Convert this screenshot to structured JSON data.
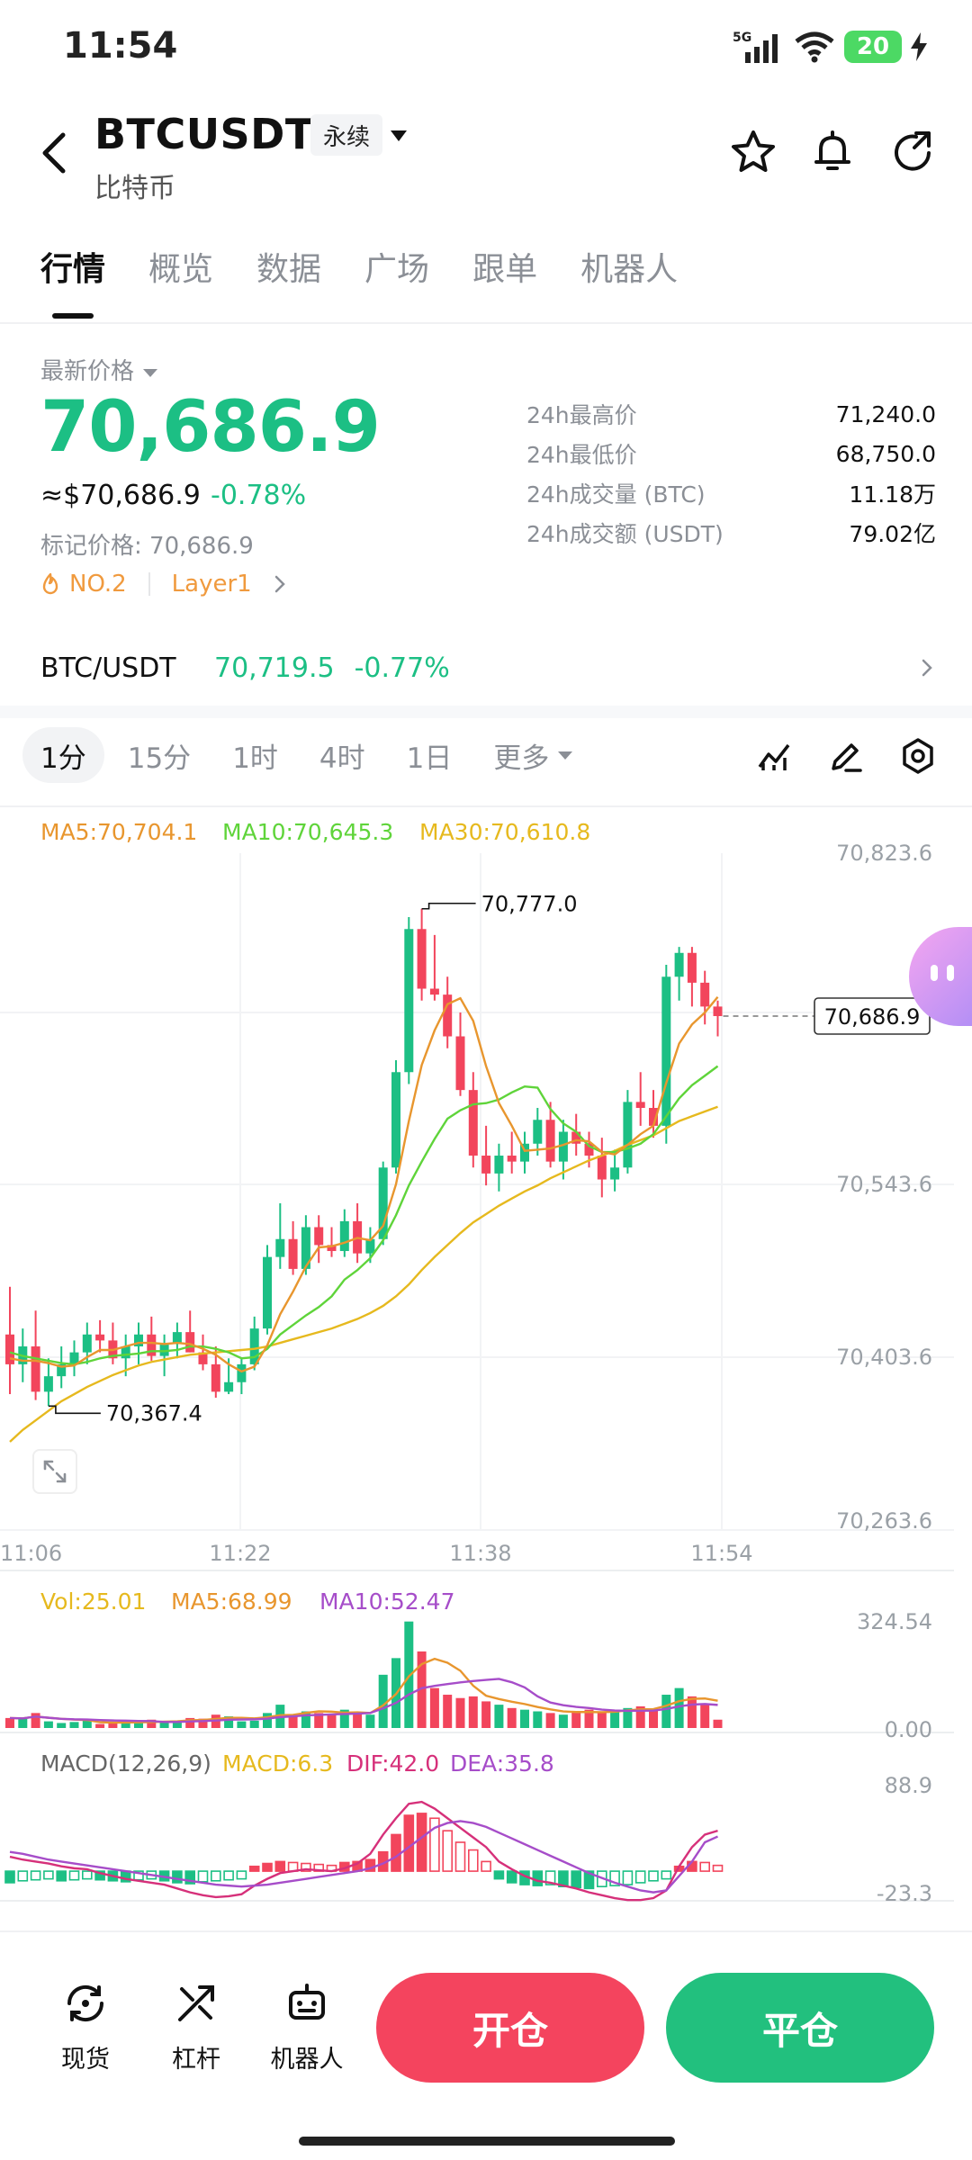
{
  "status_bar": {
    "time": "11:54",
    "network": "5G",
    "battery": "20"
  },
  "header": {
    "symbol": "BTCUSDT",
    "contract_type": "永续",
    "name": "比特币"
  },
  "tabs": [
    {
      "label": "行情"
    },
    {
      "label": "概览"
    },
    {
      "label": "数据"
    },
    {
      "label": "广场"
    },
    {
      "label": "跟单"
    },
    {
      "label": "机器人"
    }
  ],
  "price": {
    "label": "最新价格",
    "last": "70,686.9",
    "usd": "≈$70,686.9",
    "change": "-0.78%",
    "mark_label": "标记价格: 70,686.9",
    "rank": "NO.2",
    "category": "Layer1"
  },
  "stats": [
    {
      "label": "24h最高价",
      "value": "71,240.0"
    },
    {
      "label": "24h最低价",
      "value": "68,750.0"
    },
    {
      "label": "24h成交量 (BTC)",
      "value": "11.18万"
    },
    {
      "label": "24h成交额 (USDT)",
      "value": "79.02亿"
    }
  ],
  "spot": {
    "pair": "BTC/USDT",
    "price": "70,719.5",
    "change": "-0.77%"
  },
  "timeframes": [
    {
      "label": "1分"
    },
    {
      "label": "15分"
    },
    {
      "label": "1时"
    },
    {
      "label": "4时"
    },
    {
      "label": "1日"
    },
    {
      "label": "更多"
    }
  ],
  "ma_legend": {
    "ma5": "MA5:70,704.1",
    "ma10": "MA10:70,645.3",
    "ma30": "MA30:70,610.8"
  },
  "price_axis": [
    "70,823.6",
    "70,543.6",
    "70,403.6",
    "70,263.6"
  ],
  "time_axis": [
    "11:06",
    "11:22",
    "11:38",
    "11:54"
  ],
  "annotations": {
    "high": "70,777.0",
    "low": "70,367.4",
    "current": "70,686.9"
  },
  "vol_legend": {
    "vol": "Vol:25.01",
    "ma5": "MA5:68.99",
    "ma10": "MA10:52.47"
  },
  "vol_axis": [
    "324.54",
    "0.00"
  ],
  "macd_legend": {
    "title": "MACD(12,26,9)",
    "macd": "MACD:6.3",
    "dif": "DIF:42.0",
    "dea": "DEA:35.8"
  },
  "macd_axis": [
    "88.9",
    "-23.3"
  ],
  "bottom_nav": [
    {
      "label": "现货",
      "icon": "spot-icon"
    },
    {
      "label": "杠杆",
      "icon": "leverage-icon"
    },
    {
      "label": "机器人",
      "icon": "robot-icon"
    }
  ],
  "actions": {
    "open": "开仓",
    "close": "平仓"
  },
  "colors": {
    "up": "#1cbf84",
    "down": "#f2455c",
    "ma5": "#e8962e",
    "ma10": "#5fd43a",
    "ma30": "#e6b91e",
    "dif": "#d6307a",
    "dea": "#a64dc9"
  },
  "chart_data": {
    "type": "candlestick",
    "candles": [
      {
        "o": 70420,
        "h": 70460,
        "l": 70370,
        "c": 70395
      },
      {
        "o": 70395,
        "h": 70425,
        "l": 70380,
        "c": 70410
      },
      {
        "o": 70410,
        "h": 70440,
        "l": 70365,
        "c": 70372
      },
      {
        "o": 70372,
        "h": 70400,
        "l": 70360,
        "c": 70385
      },
      {
        "o": 70385,
        "h": 70410,
        "l": 70375,
        "c": 70395
      },
      {
        "o": 70395,
        "h": 70415,
        "l": 70385,
        "c": 70405
      },
      {
        "o": 70405,
        "h": 70430,
        "l": 70395,
        "c": 70420
      },
      {
        "o": 70420,
        "h": 70432,
        "l": 70405,
        "c": 70415
      },
      {
        "o": 70415,
        "h": 70430,
        "l": 70395,
        "c": 70400
      },
      {
        "o": 70400,
        "h": 70420,
        "l": 70385,
        "c": 70410
      },
      {
        "o": 70410,
        "h": 70430,
        "l": 70395,
        "c": 70420
      },
      {
        "o": 70420,
        "h": 70435,
        "l": 70398,
        "c": 70402
      },
      {
        "o": 70402,
        "h": 70420,
        "l": 70385,
        "c": 70412
      },
      {
        "o": 70412,
        "h": 70430,
        "l": 70400,
        "c": 70422
      },
      {
        "o": 70422,
        "h": 70440,
        "l": 70405,
        "c": 70405
      },
      {
        "o": 70405,
        "h": 70420,
        "l": 70390,
        "c": 70395
      },
      {
        "o": 70395,
        "h": 70410,
        "l": 70367,
        "c": 70372
      },
      {
        "o": 70372,
        "h": 70400,
        "l": 70370,
        "c": 70380
      },
      {
        "o": 70380,
        "h": 70400,
        "l": 70370,
        "c": 70395
      },
      {
        "o": 70395,
        "h": 70435,
        "l": 70390,
        "c": 70425
      },
      {
        "o": 70425,
        "h": 70495,
        "l": 70420,
        "c": 70485
      },
      {
        "o": 70485,
        "h": 70530,
        "l": 70475,
        "c": 70500
      },
      {
        "o": 70500,
        "h": 70515,
        "l": 70470,
        "c": 70475
      },
      {
        "o": 70475,
        "h": 70520,
        "l": 70470,
        "c": 70510
      },
      {
        "o": 70510,
        "h": 70520,
        "l": 70480,
        "c": 70495
      },
      {
        "o": 70495,
        "h": 70510,
        "l": 70485,
        "c": 70490
      },
      {
        "o": 70490,
        "h": 70525,
        "l": 70485,
        "c": 70515
      },
      {
        "o": 70515,
        "h": 70530,
        "l": 70480,
        "c": 70488
      },
      {
        "o": 70488,
        "h": 70510,
        "l": 70480,
        "c": 70500
      },
      {
        "o": 70500,
        "h": 70565,
        "l": 70495,
        "c": 70560
      },
      {
        "o": 70560,
        "h": 70650,
        "l": 70555,
        "c": 70640
      },
      {
        "o": 70640,
        "h": 70770,
        "l": 70630,
        "c": 70760
      },
      {
        "o": 70760,
        "h": 70777,
        "l": 70700,
        "c": 70710
      },
      {
        "o": 70710,
        "h": 70755,
        "l": 70700,
        "c": 70705
      },
      {
        "o": 70705,
        "h": 70720,
        "l": 70660,
        "c": 70670
      },
      {
        "o": 70670,
        "h": 70690,
        "l": 70620,
        "c": 70625
      },
      {
        "o": 70625,
        "h": 70640,
        "l": 70560,
        "c": 70570
      },
      {
        "o": 70570,
        "h": 70595,
        "l": 70545,
        "c": 70555
      },
      {
        "o": 70555,
        "h": 70580,
        "l": 70540,
        "c": 70570
      },
      {
        "o": 70570,
        "h": 70590,
        "l": 70555,
        "c": 70565
      },
      {
        "o": 70565,
        "h": 70590,
        "l": 70555,
        "c": 70580
      },
      {
        "o": 70580,
        "h": 70610,
        "l": 70570,
        "c": 70600
      },
      {
        "o": 70600,
        "h": 70615,
        "l": 70560,
        "c": 70565
      },
      {
        "o": 70565,
        "h": 70600,
        "l": 70550,
        "c": 70590
      },
      {
        "o": 70590,
        "h": 70605,
        "l": 70570,
        "c": 70580
      },
      {
        "o": 70580,
        "h": 70590,
        "l": 70560,
        "c": 70570
      },
      {
        "o": 70570,
        "h": 70585,
        "l": 70535,
        "c": 70550
      },
      {
        "o": 70550,
        "h": 70575,
        "l": 70540,
        "c": 70560
      },
      {
        "o": 70560,
        "h": 70625,
        "l": 70555,
        "c": 70615
      },
      {
        "o": 70615,
        "h": 70640,
        "l": 70595,
        "c": 70610
      },
      {
        "o": 70610,
        "h": 70625,
        "l": 70585,
        "c": 70595
      },
      {
        "o": 70595,
        "h": 70730,
        "l": 70580,
        "c": 70720
      },
      {
        "o": 70720,
        "h": 70745,
        "l": 70700,
        "c": 70740
      },
      {
        "o": 70740,
        "h": 70745,
        "l": 70695,
        "c": 70715
      },
      {
        "o": 70715,
        "h": 70725,
        "l": 70680,
        "c": 70695
      },
      {
        "o": 70695,
        "h": 70700,
        "l": 70670,
        "c": 70687
      }
    ],
    "ma5": [
      70400,
      70398,
      70398,
      70396,
      70393,
      70394,
      70401,
      70407,
      70407,
      70410,
      70413,
      70413,
      70412,
      70413,
      70412,
      70408,
      70403,
      70395,
      70389,
      70393,
      70411,
      70437,
      70456,
      70477,
      70493,
      70494,
      70497,
      70501,
      70499,
      70511,
      70546,
      70599,
      70646,
      70675,
      70697,
      70702,
      70683,
      70645,
      70614,
      70595,
      70574,
      70575,
      70576,
      70579,
      70583,
      70582,
      70573,
      70571,
      70579,
      70588,
      70595,
      70631,
      70664,
      70680,
      70690,
      70703
    ],
    "ma10": [
      70405,
      70402,
      70400,
      70398,
      70396,
      70395,
      70397,
      70400,
      70402,
      70403,
      70404,
      70406,
      70406,
      70407,
      70410,
      70410,
      70408,
      70405,
      70400,
      70401,
      70408,
      70420,
      70428,
      70436,
      70443,
      70452,
      70466,
      70474,
      70484,
      70499,
      70520,
      70545,
      70565,
      70584,
      70601,
      70608,
      70613,
      70614,
      70617,
      70623,
      70628,
      70627,
      70609,
      70597,
      70590,
      70578,
      70573,
      70573,
      70576,
      70580,
      70588,
      70603,
      70618,
      70629,
      70637,
      70645
    ],
    "ma30": [
      70330,
      70340,
      70348,
      70356,
      70364,
      70370,
      70376,
      70381,
      70386,
      70390,
      70394,
      70397,
      70399,
      70401,
      70403,
      70404,
      70405,
      70406,
      70407,
      70408,
      70410,
      70413,
      70416,
      70419,
      70422,
      70425,
      70429,
      70433,
      70438,
      70444,
      70452,
      70462,
      70474,
      70485,
      70495,
      70505,
      70514,
      70521,
      70528,
      70534,
      70540,
      70545,
      70551,
      70556,
      70561,
      70566,
      70570,
      70574,
      70579,
      70583,
      70587,
      70593,
      70599,
      70603,
      70607,
      70611
    ],
    "volume": [
      30,
      28,
      45,
      20,
      15,
      18,
      22,
      12,
      14,
      16,
      22,
      25,
      18,
      20,
      30,
      28,
      40,
      35,
      20,
      22,
      45,
      70,
      40,
      50,
      45,
      40,
      55,
      45,
      40,
      160,
      210,
      320,
      230,
      120,
      100,
      90,
      95,
      80,
      70,
      60,
      55,
      50,
      45,
      40,
      50,
      55,
      48,
      52,
      60,
      65,
      58,
      100,
      120,
      95,
      70,
      25
    ],
    "macd": [
      -12,
      -10,
      -9,
      -8,
      -10,
      -9,
      -8,
      -9,
      -10,
      -11,
      -9,
      -8,
      -10,
      -12,
      -13,
      -11,
      -10,
      -9,
      -8,
      5,
      8,
      10,
      9,
      8,
      7,
      6,
      9,
      10,
      12,
      20,
      38,
      58,
      60,
      55,
      42,
      30,
      22,
      10,
      -8,
      -12,
      -14,
      -15,
      -14,
      -16,
      -17,
      -18,
      -16,
      -15,
      -14,
      -12,
      -10,
      -8,
      5,
      10,
      9,
      6
    ],
    "dif": [
      15,
      12,
      10,
      8,
      5,
      3,
      2,
      -2,
      -5,
      -8,
      -10,
      -12,
      -14,
      -18,
      -22,
      -25,
      -27,
      -26,
      -24,
      -15,
      -8,
      -2,
      0,
      2,
      1,
      0,
      3,
      8,
      18,
      38,
      55,
      70,
      72,
      65,
      55,
      45,
      35,
      25,
      10,
      2,
      -5,
      -10,
      -12,
      -15,
      -18,
      -22,
      -25,
      -28,
      -30,
      -30,
      -28,
      -20,
      5,
      25,
      38,
      42
    ],
    "dea": [
      20,
      18,
      15,
      12,
      10,
      8,
      6,
      4,
      2,
      0,
      -2,
      -4,
      -6,
      -8,
      -10,
      -12,
      -14,
      -15,
      -16,
      -15,
      -14,
      -12,
      -10,
      -8,
      -6,
      -4,
      -2,
      0,
      3,
      8,
      15,
      25,
      35,
      45,
      50,
      52,
      50,
      46,
      40,
      34,
      28,
      22,
      16,
      10,
      4,
      -2,
      -7,
      -12,
      -16,
      -20,
      -22,
      -20,
      -5,
      10,
      30,
      36
    ],
    "price_range": [
      70263.6,
      70823.6
    ],
    "vol_range": [
      0,
      324.54
    ],
    "macd_range": [
      -23.3,
      88.9
    ]
  }
}
